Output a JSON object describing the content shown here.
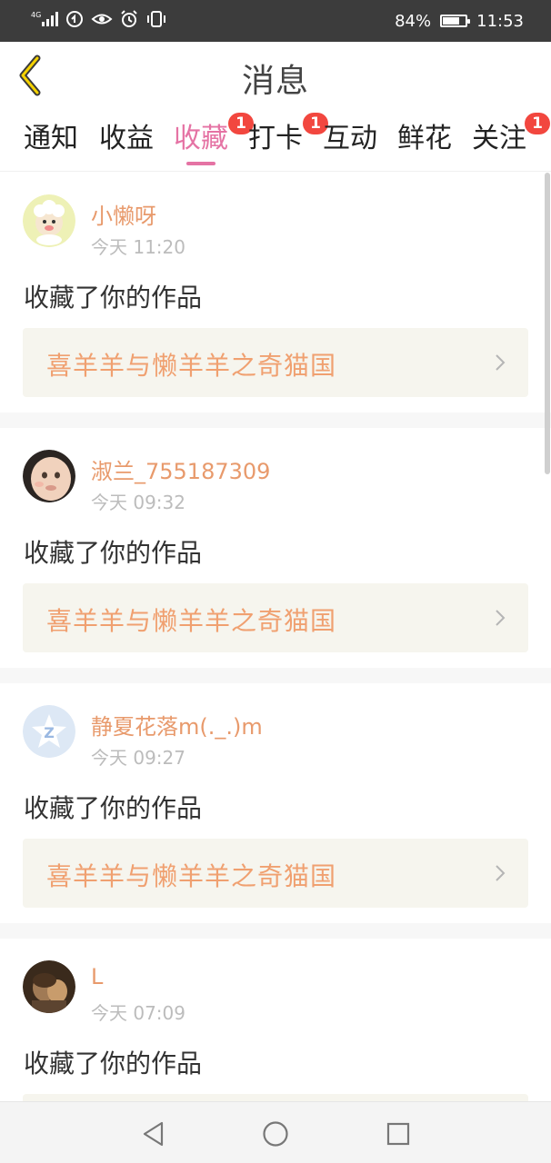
{
  "status_bar": {
    "network": "4G",
    "battery": "84%",
    "battery_level": 0.84,
    "time": "11:53"
  },
  "header": {
    "title": "消息",
    "back_icon": "chevron-left-icon"
  },
  "tabs": [
    {
      "label": "通知",
      "active": false,
      "badge": ""
    },
    {
      "label": "收益",
      "active": false,
      "badge": ""
    },
    {
      "label": "收藏",
      "active": true,
      "badge": "1"
    },
    {
      "label": "打卡",
      "active": false,
      "badge": "1"
    },
    {
      "label": "互动",
      "active": false,
      "badge": ""
    },
    {
      "label": "鲜花",
      "active": false,
      "badge": ""
    },
    {
      "label": "关注",
      "active": false,
      "badge": "1"
    }
  ],
  "messages": [
    {
      "name": "小懒呀",
      "time": "今天 11:20",
      "action": "收藏了你的作品",
      "work": "喜羊羊与懒羊羊之奇猫国"
    },
    {
      "name": "淑兰_755187309",
      "time": "今天 09:32",
      "action": "收藏了你的作品",
      "work": "喜羊羊与懒羊羊之奇猫国"
    },
    {
      "name": "静夏花落m(._.)m",
      "time": "今天 09:27",
      "action": "收藏了你的作品",
      "work": "喜羊羊与懒羊羊之奇猫国"
    },
    {
      "name": "L",
      "time": "今天 07:09",
      "action": "收藏了你的作品",
      "work": ""
    }
  ],
  "colors": {
    "accent": "#e573a4",
    "username": "#e89a6c",
    "work_title": "#f0a070",
    "badge": "#f2473f"
  },
  "navbar": {
    "back_icon": "triangle-back-icon",
    "home_icon": "circle-home-icon",
    "recents_icon": "square-recents-icon"
  }
}
